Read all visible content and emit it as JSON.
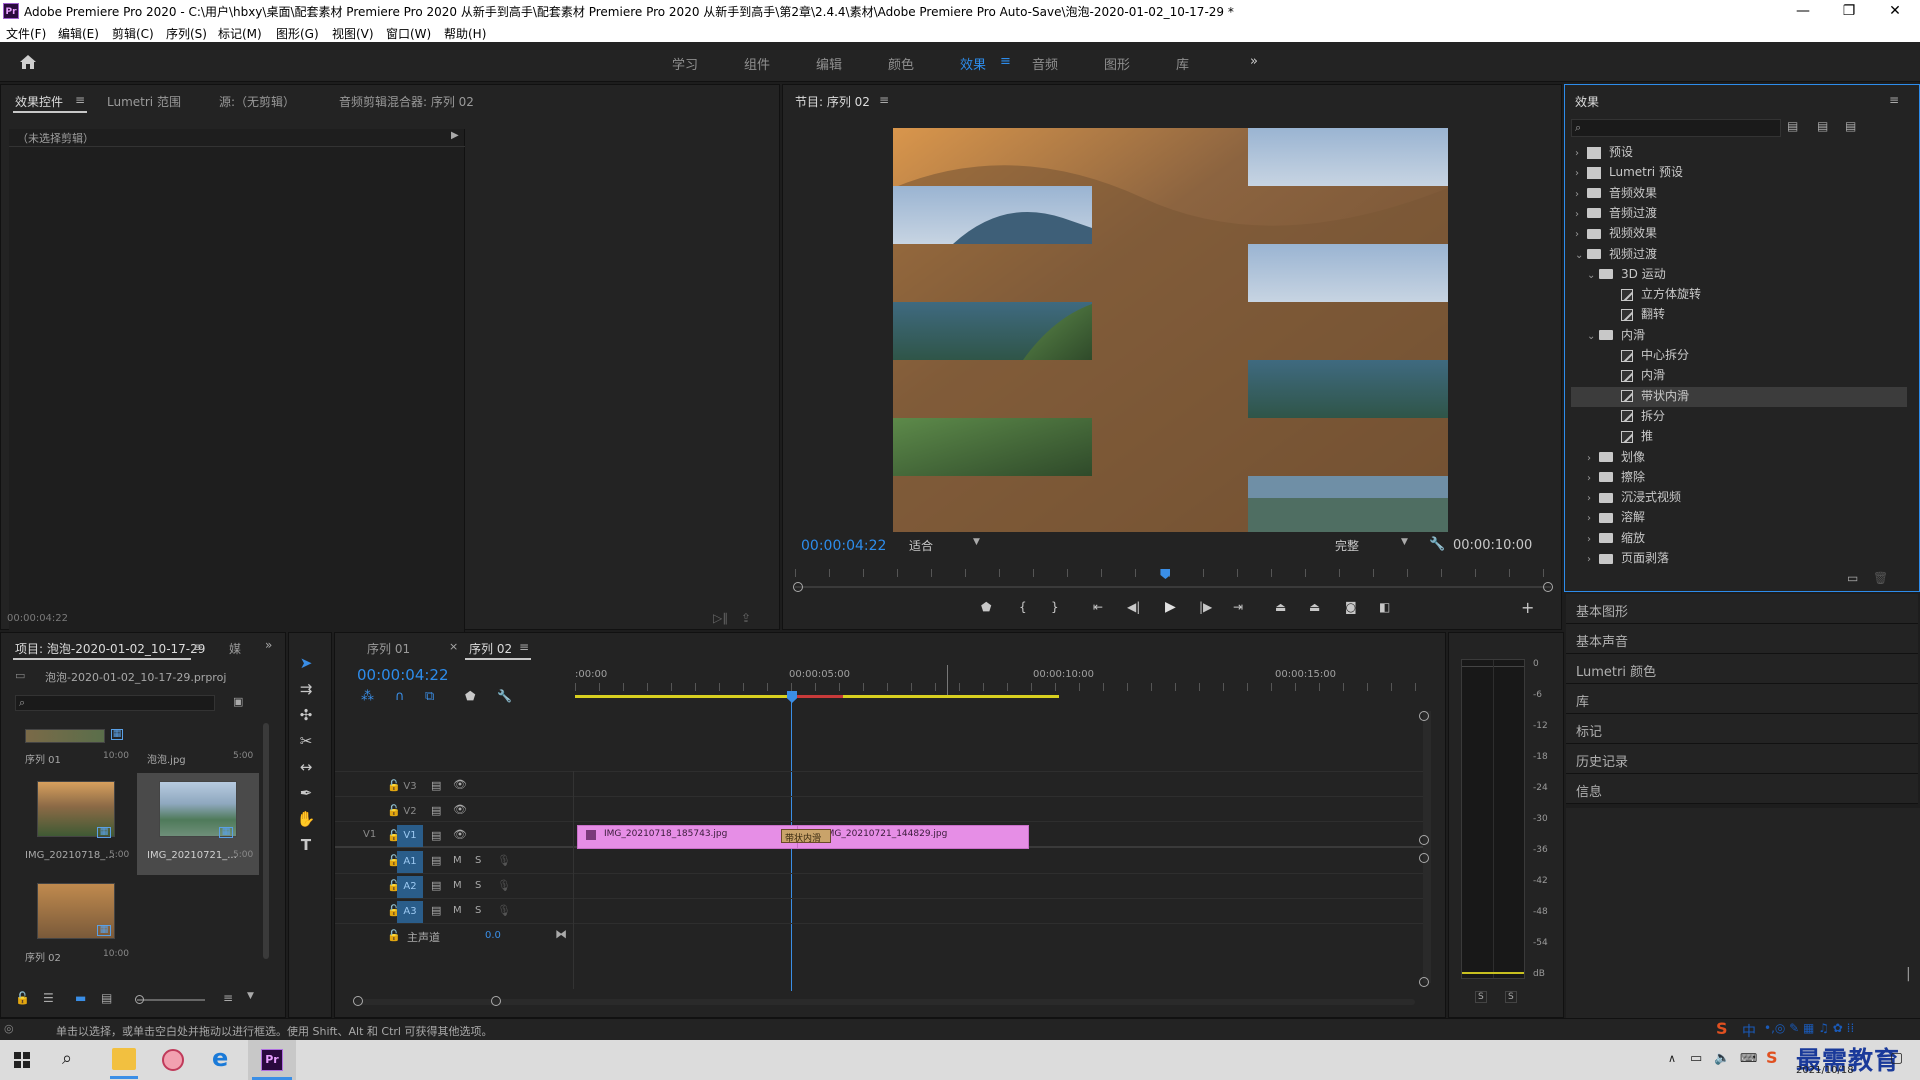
{
  "window": {
    "title": "Adobe Premiere Pro 2020 - C:\\用户\\hbxy\\桌面\\配套素材 Premiere Pro 2020 从新手到高手\\配套素材 Premiere Pro 2020 从新手到高手\\第2章\\2.4.4\\素材\\Adobe Premiere Pro Auto-Save\\泡泡-2020-01-02_10-17-29 *",
    "app_logo": "Pr"
  },
  "menu": [
    "文件(F)",
    "编辑(E)",
    "剪辑(C)",
    "序列(S)",
    "标记(M)",
    "图形(G)",
    "视图(V)",
    "窗口(W)",
    "帮助(H)"
  ],
  "workspaces": [
    "学习",
    "组件",
    "编辑",
    "颜色",
    "效果",
    "音频",
    "图形",
    "库"
  ],
  "workspace_active": "效果",
  "workspace_more": "»",
  "top_left_panel": {
    "tabs": [
      "效果控件",
      "Lumetri 范围",
      "源:（无剪辑）",
      "音频剪辑混合器: 序列 02"
    ],
    "no_clip": "（未选择剪辑）",
    "timecode": "00:00:04:22"
  },
  "program_monitor": {
    "title": "节目: 序列 02",
    "timecode": "00:00:04:22",
    "fit": "适合",
    "quality": "完整",
    "duration": "00:00:10:00",
    "playhead_fraction": 0.49
  },
  "effects_panel": {
    "title": "效果",
    "search_placeholder": "",
    "tree": [
      {
        "label": "预设",
        "level": 0,
        "kind": "preset",
        "open": false
      },
      {
        "label": "Lumetri 预设",
        "level": 0,
        "kind": "preset",
        "open": false
      },
      {
        "label": "音频效果",
        "level": 0,
        "kind": "folder",
        "open": false
      },
      {
        "label": "音频过渡",
        "level": 0,
        "kind": "folder",
        "open": false
      },
      {
        "label": "视频效果",
        "level": 0,
        "kind": "folder",
        "open": false
      },
      {
        "label": "视频过渡",
        "level": 0,
        "kind": "folder",
        "open": true
      },
      {
        "label": "3D 运动",
        "level": 1,
        "kind": "folder",
        "open": true
      },
      {
        "label": "立方体旋转",
        "level": 2,
        "kind": "fx"
      },
      {
        "label": "翻转",
        "level": 2,
        "kind": "fx"
      },
      {
        "label": "内滑",
        "level": 1,
        "kind": "folder",
        "open": true
      },
      {
        "label": "中心拆分",
        "level": 2,
        "kind": "fx"
      },
      {
        "label": "内滑",
        "level": 2,
        "kind": "fx"
      },
      {
        "label": "带状内滑",
        "level": 2,
        "kind": "fx",
        "selected": true
      },
      {
        "label": "拆分",
        "level": 2,
        "kind": "fx"
      },
      {
        "label": "推",
        "level": 2,
        "kind": "fx"
      },
      {
        "label": "划像",
        "level": 1,
        "kind": "folder",
        "open": false
      },
      {
        "label": "擦除",
        "level": 1,
        "kind": "folder",
        "open": false
      },
      {
        "label": "沉浸式视频",
        "level": 1,
        "kind": "folder",
        "open": false
      },
      {
        "label": "溶解",
        "level": 1,
        "kind": "folder",
        "open": false
      },
      {
        "label": "缩放",
        "level": 1,
        "kind": "folder",
        "open": false
      },
      {
        "label": "页面剥落",
        "level": 1,
        "kind": "folder",
        "open": false
      }
    ]
  },
  "side_sections": [
    "基本图形",
    "基本声音",
    "Lumetri 颜色",
    "库",
    "标记",
    "历史记录",
    "信息"
  ],
  "project_panel": {
    "tab": "项目: 泡泡-2020-01-02_10-17-29",
    "tab2": "媒",
    "file": "泡泡-2020-01-02_10-17-29.prproj",
    "items": [
      {
        "name": "序列 01",
        "duration": "10:00"
      },
      {
        "name": "泡泡.jpg",
        "duration": "5:00"
      },
      {
        "name": "IMG_20210718_...",
        "duration": "5:00"
      },
      {
        "name": "IMG_20210721_...",
        "duration": "5:00"
      },
      {
        "name": "序列 02",
        "duration": "10:00"
      }
    ]
  },
  "timeline": {
    "tabs": [
      "序列 01",
      "序列 02"
    ],
    "active_tab": "序列 02",
    "timecode": "00:00:04:22",
    "ruler": [
      ":00:00",
      "00:00:05:00",
      "00:00:10:00",
      "00:00:15:00"
    ],
    "video_tracks": [
      "V3",
      "V2",
      "V1"
    ],
    "audio_tracks": [
      "A1",
      "A2",
      "A3"
    ],
    "source_patch": "V1",
    "master_label": "主声道",
    "master_value": "0.0",
    "clips": [
      {
        "name": "IMG_20210718_185743.jpg",
        "track": "V1"
      },
      {
        "name": "IMG_20210721_144829.jpg",
        "track": "V1"
      }
    ],
    "transition": "带状内滑",
    "mute_label": "M",
    "solo_label": "S"
  },
  "audio_meter": {
    "scale": [
      "0",
      "-6",
      "-12",
      "-18",
      "-24",
      "-30",
      "-36",
      "-42",
      "-48",
      "-54",
      "dB"
    ],
    "solo": [
      "S",
      "S"
    ]
  },
  "status_bar": "单击以选择，或单击空白处并拖动以进行框选。使用 Shift、Alt 和 Ctrl 可获得其他选项。",
  "taskbar": {
    "watermark": "最需教育",
    "date": "2021/10/18",
    "ime": "中"
  }
}
